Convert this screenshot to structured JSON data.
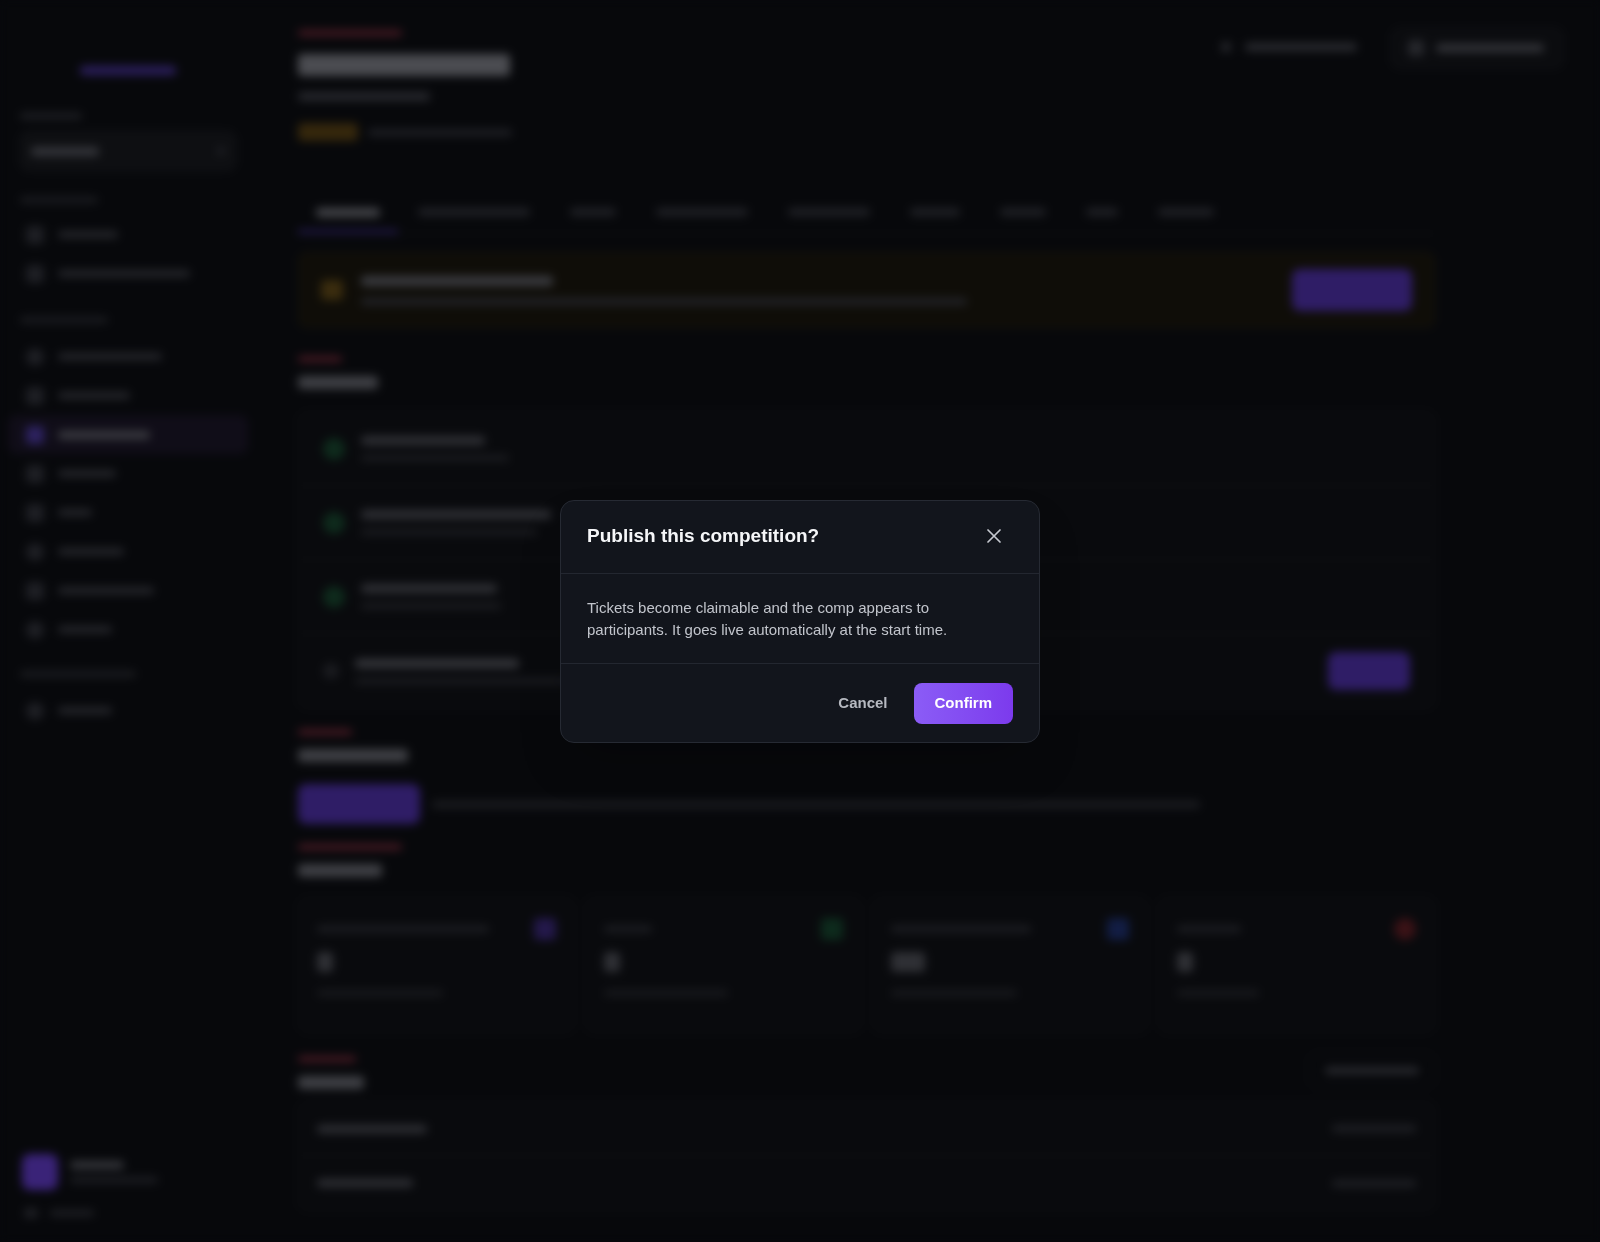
{
  "dialog": {
    "title": "Publish this competition?",
    "message": "Tickets become claimable and the comp appears to participants. It goes live automatically at the start time.",
    "buttons": [
      {
        "label": "Cancel",
        "kind": "secondary"
      },
      {
        "label": "Confirm",
        "kind": "primary"
      }
    ]
  }
}
